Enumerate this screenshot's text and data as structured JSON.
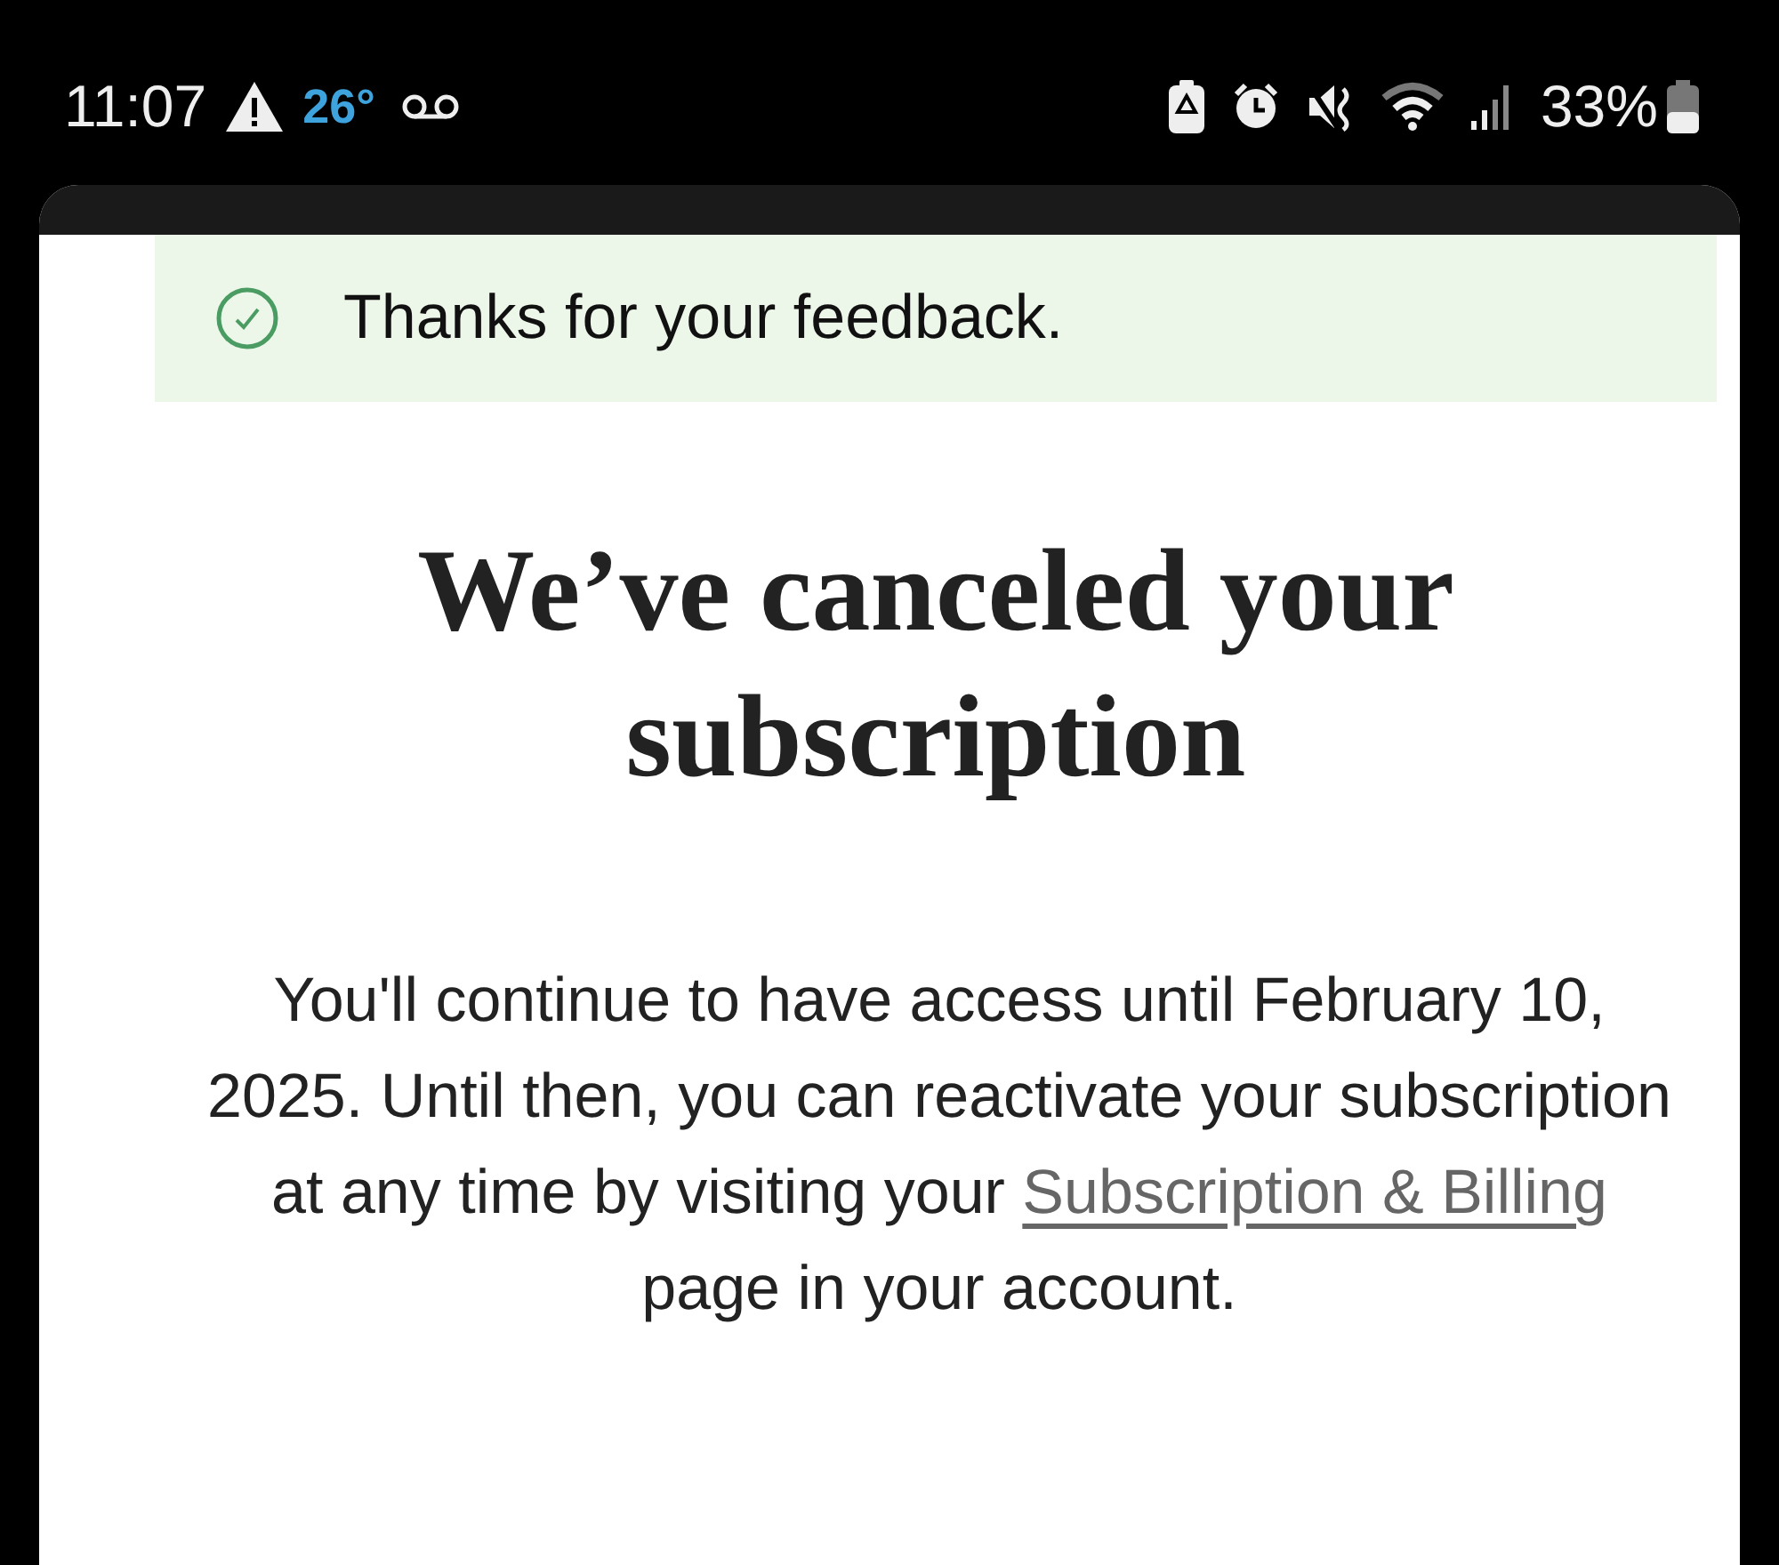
{
  "status_bar": {
    "time": "11:07",
    "temperature": "26°",
    "battery": "33%"
  },
  "banner": {
    "message": "Thanks for your feedback."
  },
  "heading": "We’ve canceled your subscription",
  "body": {
    "before": "You'll continue to have access until February 10, 2025. Until then, you can reactivate your subscription at any time by visiting your",
    "link": "Subscription & Billing",
    "after": "page in your account."
  }
}
